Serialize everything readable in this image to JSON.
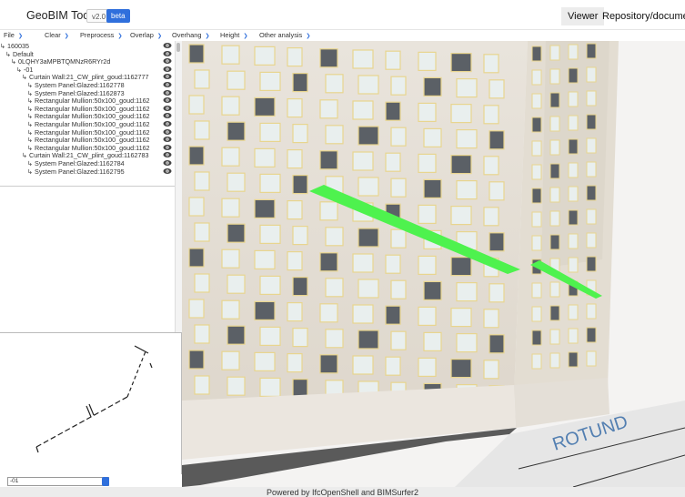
{
  "app": {
    "title": "GeoBIM Tool",
    "version": "v2.0",
    "badge": "beta"
  },
  "nav": {
    "tabs": [
      "Viewer",
      "Repository/documenta"
    ]
  },
  "menu": {
    "items": [
      "File",
      "Clear",
      "Preprocess",
      "Overlap",
      "Overhang",
      "Height",
      "Other analysis"
    ]
  },
  "tree": {
    "rows": [
      "↳ 160035",
      "↳ Default",
      "↳ 0LQHY3aMPBTQMNzR6RYr2d",
      "↳ -01",
      "↳ Curtain Wall:21_CW_plint_goud:1162777",
      "↳ System Panel:Glazed:1162778",
      "↳ System Panel:Glazed:1162873",
      "↳ Rectangular Mullion:50x100_goud:1162",
      "↳ Rectangular Mullion:50x100_goud:1162",
      "↳ Rectangular Mullion:50x100_goud:1162",
      "↳ Rectangular Mullion:50x100_goud:1162",
      "↳ Rectangular Mullion:50x100_goud:1162",
      "↳ Rectangular Mullion:50x100_goud:1162",
      "↳ Rectangular Mullion:50x100_goud:1162",
      "↳ Curtain Wall:21_CW_plint_goud:1162783",
      "↳ System Panel:Glazed:1162784",
      "↳ System Panel:Glazed:1162795"
    ]
  },
  "level_select": {
    "value": "-01"
  },
  "footer": {
    "text": "Powered by IfcOpenShell and BIMSurfer2"
  },
  "colors": {
    "accent": "#2f6fdc",
    "highlight": "#4ef24e",
    "facade": "#e7e1d6"
  }
}
